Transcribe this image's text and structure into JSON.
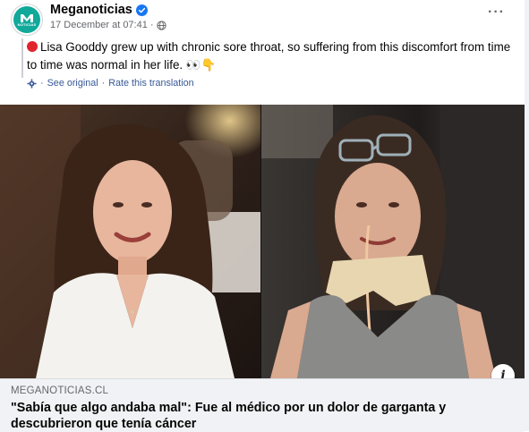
{
  "post": {
    "page_name": "Meganoticias",
    "verified_icon": "verified-badge-icon",
    "timestamp": "17 December at 07:41",
    "separator": "·",
    "audience_icon": "globe-icon",
    "more_label": "···",
    "avatar": {
      "text": "M",
      "subtext": "NOTICIAS",
      "color": "#10a99a"
    },
    "text": "Lisa Gooddy grew up with chronic sore throat, so suffering from this discomfort from time to time was normal in her life. 👀👇",
    "text_emoji_lead": "red-circle-icon",
    "translation": {
      "icon": "gear-icon",
      "see_original": "See original",
      "separator": "·",
      "rate": "Rate this translation"
    }
  },
  "image": {
    "left_alt": "Smiling woman with shoulder-length brown hair in a white blazer at a restaurant",
    "right_alt": "Woman in hospital with a feeding tube, gauze on neck, glasses on head, grey tank top",
    "info_label": "i"
  },
  "link_preview": {
    "domain": "MEGANOTICIAS.CL",
    "headline": "\"Sabía que algo andaba mal\": Fue al médico por un dolor de garganta y descubrieron que tenía cáncer"
  },
  "colors": {
    "brand": "#10a99a",
    "link": "#385898",
    "verified": "#1877f2",
    "footer_bg": "#f0f2f5"
  }
}
